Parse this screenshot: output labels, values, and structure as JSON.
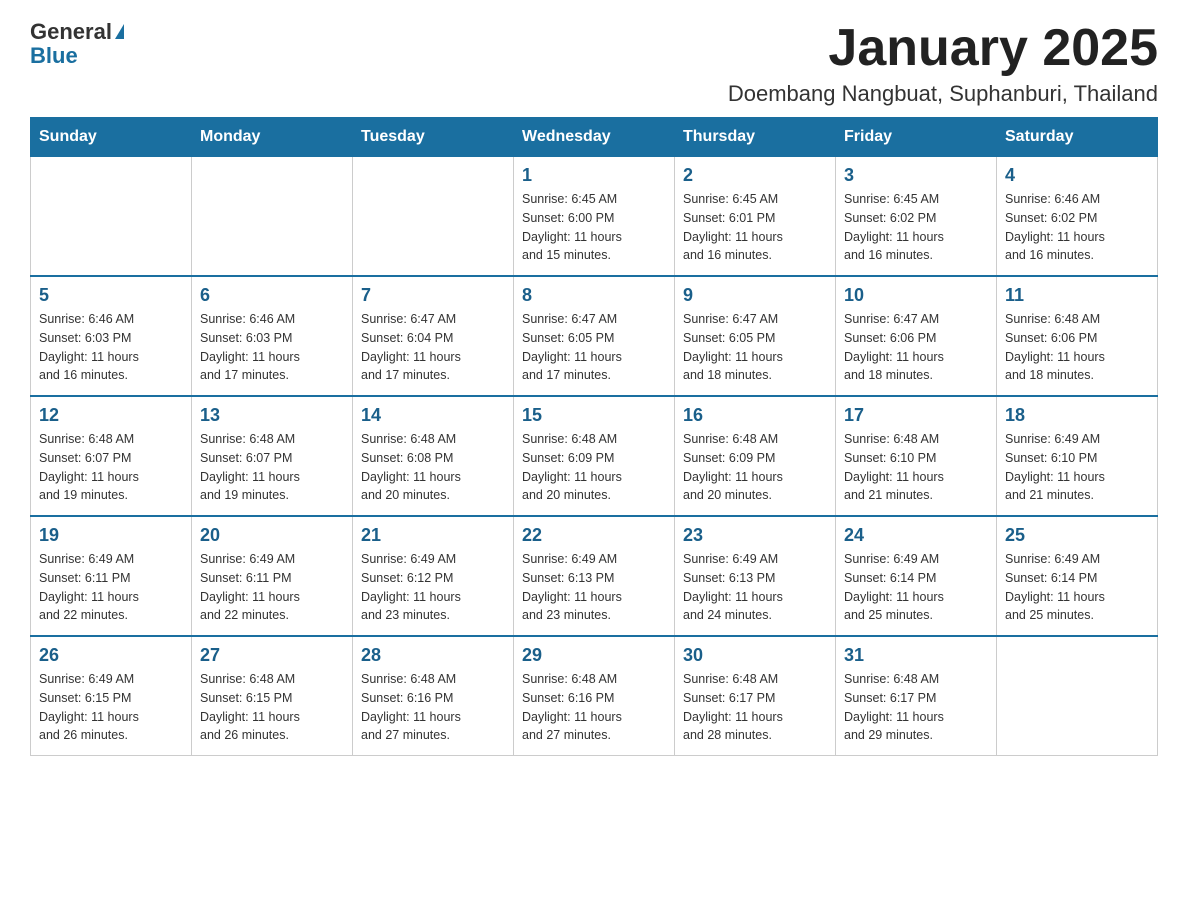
{
  "logo": {
    "text_general": "General",
    "text_blue": "Blue",
    "arrow_color": "#1a6fa0"
  },
  "header": {
    "title": "January 2025",
    "subtitle": "Doembang Nangbuat, Suphanburi, Thailand"
  },
  "days_of_week": [
    "Sunday",
    "Monday",
    "Tuesday",
    "Wednesday",
    "Thursday",
    "Friday",
    "Saturday"
  ],
  "weeks": [
    {
      "days": [
        {
          "num": "",
          "info": ""
        },
        {
          "num": "",
          "info": ""
        },
        {
          "num": "",
          "info": ""
        },
        {
          "num": "1",
          "info": "Sunrise: 6:45 AM\nSunset: 6:00 PM\nDaylight: 11 hours\nand 15 minutes."
        },
        {
          "num": "2",
          "info": "Sunrise: 6:45 AM\nSunset: 6:01 PM\nDaylight: 11 hours\nand 16 minutes."
        },
        {
          "num": "3",
          "info": "Sunrise: 6:45 AM\nSunset: 6:02 PM\nDaylight: 11 hours\nand 16 minutes."
        },
        {
          "num": "4",
          "info": "Sunrise: 6:46 AM\nSunset: 6:02 PM\nDaylight: 11 hours\nand 16 minutes."
        }
      ]
    },
    {
      "days": [
        {
          "num": "5",
          "info": "Sunrise: 6:46 AM\nSunset: 6:03 PM\nDaylight: 11 hours\nand 16 minutes."
        },
        {
          "num": "6",
          "info": "Sunrise: 6:46 AM\nSunset: 6:03 PM\nDaylight: 11 hours\nand 17 minutes."
        },
        {
          "num": "7",
          "info": "Sunrise: 6:47 AM\nSunset: 6:04 PM\nDaylight: 11 hours\nand 17 minutes."
        },
        {
          "num": "8",
          "info": "Sunrise: 6:47 AM\nSunset: 6:05 PM\nDaylight: 11 hours\nand 17 minutes."
        },
        {
          "num": "9",
          "info": "Sunrise: 6:47 AM\nSunset: 6:05 PM\nDaylight: 11 hours\nand 18 minutes."
        },
        {
          "num": "10",
          "info": "Sunrise: 6:47 AM\nSunset: 6:06 PM\nDaylight: 11 hours\nand 18 minutes."
        },
        {
          "num": "11",
          "info": "Sunrise: 6:48 AM\nSunset: 6:06 PM\nDaylight: 11 hours\nand 18 minutes."
        }
      ]
    },
    {
      "days": [
        {
          "num": "12",
          "info": "Sunrise: 6:48 AM\nSunset: 6:07 PM\nDaylight: 11 hours\nand 19 minutes."
        },
        {
          "num": "13",
          "info": "Sunrise: 6:48 AM\nSunset: 6:07 PM\nDaylight: 11 hours\nand 19 minutes."
        },
        {
          "num": "14",
          "info": "Sunrise: 6:48 AM\nSunset: 6:08 PM\nDaylight: 11 hours\nand 20 minutes."
        },
        {
          "num": "15",
          "info": "Sunrise: 6:48 AM\nSunset: 6:09 PM\nDaylight: 11 hours\nand 20 minutes."
        },
        {
          "num": "16",
          "info": "Sunrise: 6:48 AM\nSunset: 6:09 PM\nDaylight: 11 hours\nand 20 minutes."
        },
        {
          "num": "17",
          "info": "Sunrise: 6:48 AM\nSunset: 6:10 PM\nDaylight: 11 hours\nand 21 minutes."
        },
        {
          "num": "18",
          "info": "Sunrise: 6:49 AM\nSunset: 6:10 PM\nDaylight: 11 hours\nand 21 minutes."
        }
      ]
    },
    {
      "days": [
        {
          "num": "19",
          "info": "Sunrise: 6:49 AM\nSunset: 6:11 PM\nDaylight: 11 hours\nand 22 minutes."
        },
        {
          "num": "20",
          "info": "Sunrise: 6:49 AM\nSunset: 6:11 PM\nDaylight: 11 hours\nand 22 minutes."
        },
        {
          "num": "21",
          "info": "Sunrise: 6:49 AM\nSunset: 6:12 PM\nDaylight: 11 hours\nand 23 minutes."
        },
        {
          "num": "22",
          "info": "Sunrise: 6:49 AM\nSunset: 6:13 PM\nDaylight: 11 hours\nand 23 minutes."
        },
        {
          "num": "23",
          "info": "Sunrise: 6:49 AM\nSunset: 6:13 PM\nDaylight: 11 hours\nand 24 minutes."
        },
        {
          "num": "24",
          "info": "Sunrise: 6:49 AM\nSunset: 6:14 PM\nDaylight: 11 hours\nand 25 minutes."
        },
        {
          "num": "25",
          "info": "Sunrise: 6:49 AM\nSunset: 6:14 PM\nDaylight: 11 hours\nand 25 minutes."
        }
      ]
    },
    {
      "days": [
        {
          "num": "26",
          "info": "Sunrise: 6:49 AM\nSunset: 6:15 PM\nDaylight: 11 hours\nand 26 minutes."
        },
        {
          "num": "27",
          "info": "Sunrise: 6:48 AM\nSunset: 6:15 PM\nDaylight: 11 hours\nand 26 minutes."
        },
        {
          "num": "28",
          "info": "Sunrise: 6:48 AM\nSunset: 6:16 PM\nDaylight: 11 hours\nand 27 minutes."
        },
        {
          "num": "29",
          "info": "Sunrise: 6:48 AM\nSunset: 6:16 PM\nDaylight: 11 hours\nand 27 minutes."
        },
        {
          "num": "30",
          "info": "Sunrise: 6:48 AM\nSunset: 6:17 PM\nDaylight: 11 hours\nand 28 minutes."
        },
        {
          "num": "31",
          "info": "Sunrise: 6:48 AM\nSunset: 6:17 PM\nDaylight: 11 hours\nand 29 minutes."
        },
        {
          "num": "",
          "info": ""
        }
      ]
    }
  ]
}
